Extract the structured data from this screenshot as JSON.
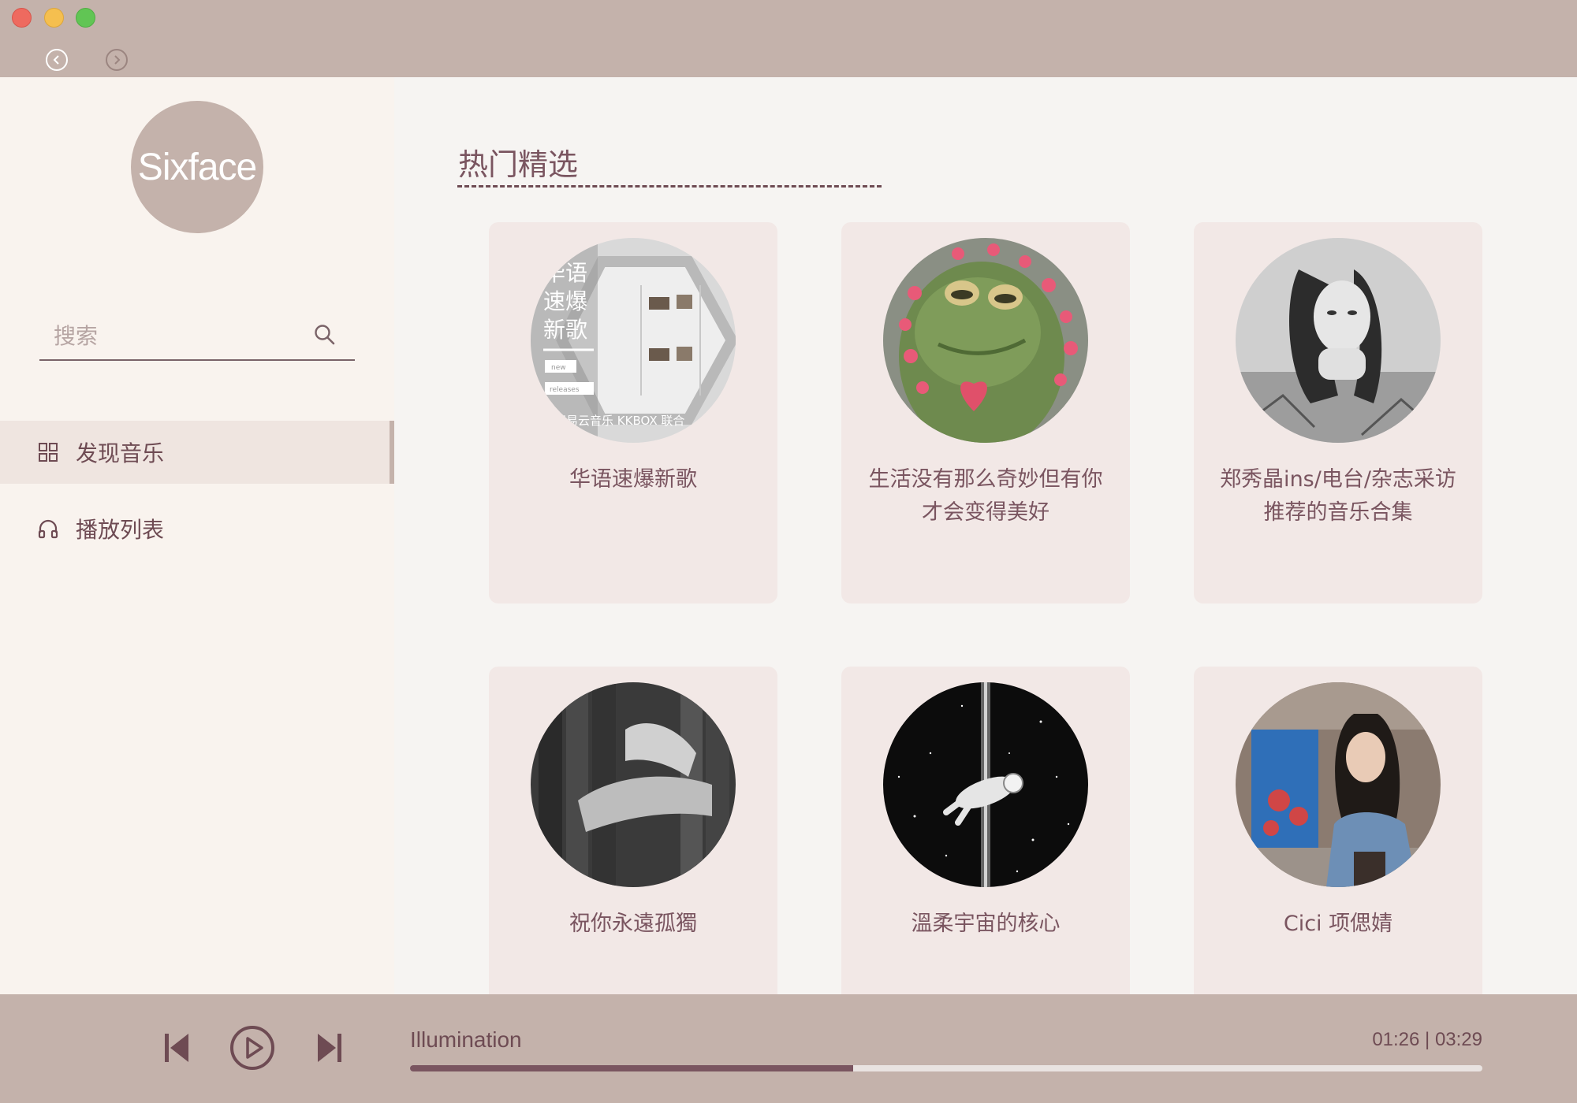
{
  "window": {
    "traffic_lights": [
      "close",
      "minimize",
      "zoom"
    ]
  },
  "nav": {
    "back_icon": "chevron-left-icon",
    "forward_icon": "chevron-right-icon"
  },
  "sidebar": {
    "logo_text": "Sixface",
    "search": {
      "placeholder": "搜索",
      "value": ""
    },
    "items": [
      {
        "label": "发现音乐",
        "icon": "grid-icon",
        "active": true
      },
      {
        "label": "播放列表",
        "icon": "headphones-icon",
        "active": false
      }
    ]
  },
  "main": {
    "section_title": "热门精选",
    "playlists": [
      {
        "title": "华语速爆新歌",
        "cover_text": [
          "华语",
          "速爆",
          "新歌",
          "new",
          "releases",
          "网易云音乐 KKBOX 联合"
        ]
      },
      {
        "title": "生活没有那么奇妙但有你才会变得美好"
      },
      {
        "title": "郑秀晶ins/电台/杂志采访推荐的音乐合集"
      },
      {
        "title": "祝你永遠孤獨"
      },
      {
        "title": "溫柔宇宙的核心"
      },
      {
        "title": "Cici 项偲婧"
      }
    ]
  },
  "player": {
    "song_title": "Illumination",
    "time_display": "01:26 | 03:29",
    "progress_fraction": 0.413,
    "controls": [
      "previous",
      "play",
      "next"
    ]
  },
  "colors": {
    "chrome": "#c4b2ab",
    "sidebar_bg": "#f9f3ee",
    "main_bg": "#f6f4f2",
    "card_bg": "#f2e8e6",
    "accent": "#6e4b53"
  }
}
